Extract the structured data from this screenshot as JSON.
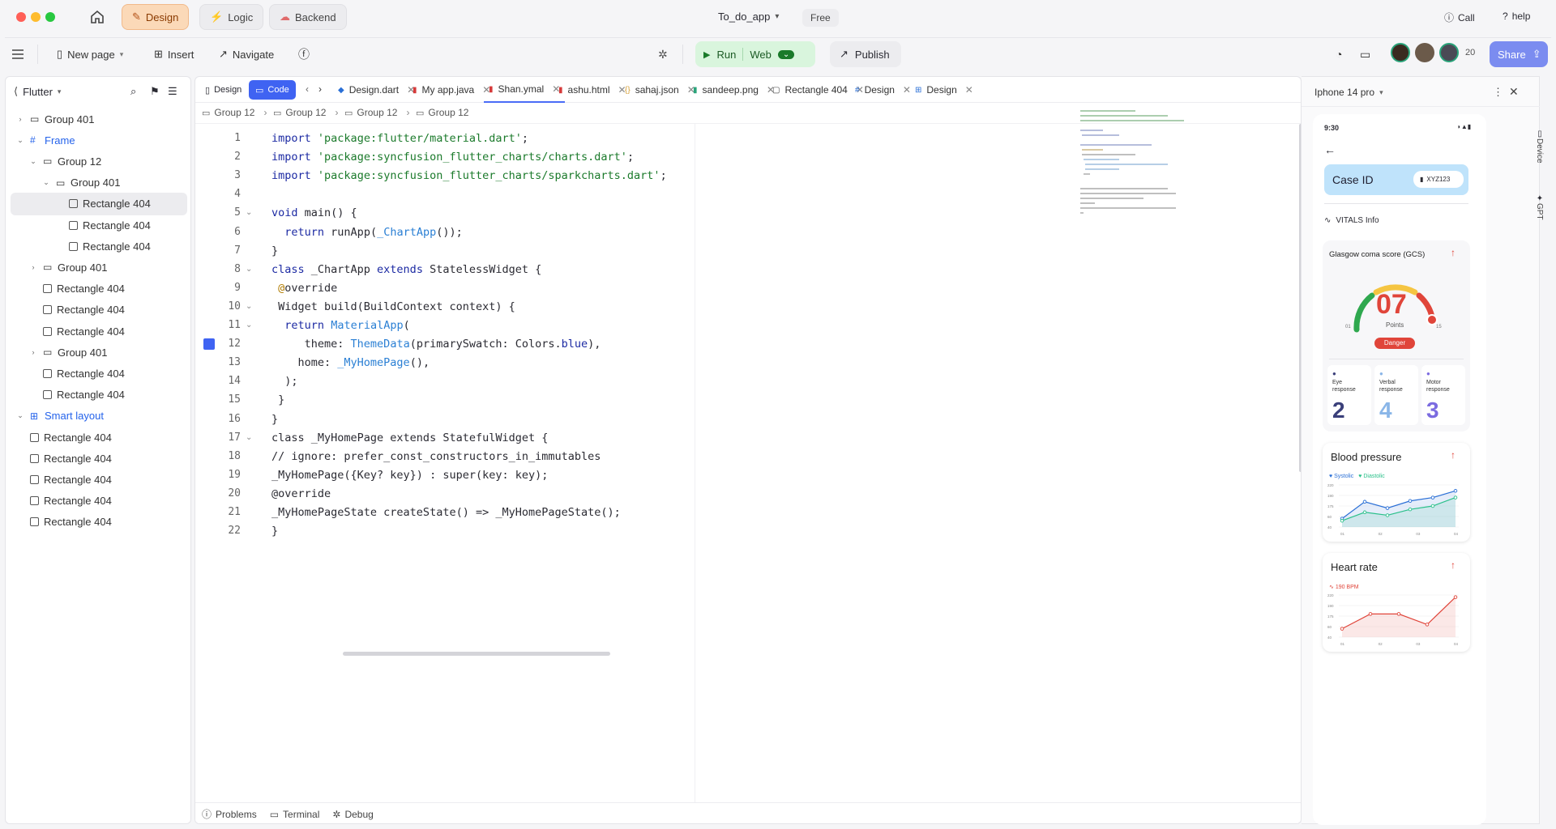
{
  "titlebar": {
    "modes": [
      {
        "label": "Design",
        "icon": "design-tools-icon",
        "active": true
      },
      {
        "label": "Logic",
        "icon": "lightning-icon",
        "active": false
      },
      {
        "label": "Backend",
        "icon": "cloud-icon",
        "active": false
      }
    ],
    "project_name": "To_do_app",
    "plan_badge": "Free",
    "call_label": "Call",
    "help_label": "help"
  },
  "toolbar": {
    "new_page": "New page",
    "insert": "Insert",
    "navigate": "Navigate",
    "run": "Run",
    "web": "Web",
    "publish": "Publish",
    "collaborator_count": "20",
    "share": "Share"
  },
  "sidebar": {
    "framework": "Flutter",
    "tree": [
      {
        "label": "Group 401",
        "type": "folder",
        "indent": 0,
        "chev": "right"
      },
      {
        "label": "Frame",
        "type": "frame",
        "indent": 0,
        "chev": "down",
        "blue": true
      },
      {
        "label": "Group 12",
        "type": "folder",
        "indent": 1,
        "chev": "down"
      },
      {
        "label": "Group 401",
        "type": "folder",
        "indent": 2,
        "chev": "down"
      },
      {
        "label": "Rectangle 404",
        "type": "rect",
        "indent": 3,
        "selected": true
      },
      {
        "label": "Rectangle 404",
        "type": "rect",
        "indent": 3
      },
      {
        "label": "Rectangle 404",
        "type": "rect",
        "indent": 3
      },
      {
        "label": "Group 401",
        "type": "folder",
        "indent": 1,
        "chev": "right"
      },
      {
        "label": "Rectangle 404",
        "type": "rect",
        "indent": 1
      },
      {
        "label": "Rectangle 404",
        "type": "rect",
        "indent": 1
      },
      {
        "label": "Rectangle 404",
        "type": "rect",
        "indent": 1
      },
      {
        "label": "Group 401",
        "type": "folder",
        "indent": 1,
        "chev": "right"
      },
      {
        "label": "Rectangle 404",
        "type": "rect",
        "indent": 1
      },
      {
        "label": "Rectangle 404",
        "type": "rect",
        "indent": 1
      },
      {
        "label": "Smart layout",
        "type": "layout",
        "indent": 0,
        "chev": "down",
        "blue": true
      },
      {
        "label": "Rectangle 404",
        "type": "rect",
        "indent": 0
      },
      {
        "label": "Rectangle 404",
        "type": "rect",
        "indent": 0
      },
      {
        "label": "Rectangle 404",
        "type": "rect",
        "indent": 0
      },
      {
        "label": "Rectangle 404",
        "type": "rect",
        "indent": 0
      },
      {
        "label": "Rectangle 404",
        "type": "rect",
        "indent": 0
      }
    ]
  },
  "editor": {
    "view_toggle": {
      "design": "Design",
      "code": "Code"
    },
    "tabs": [
      {
        "label": "Design.dart",
        "icon": "dart-icon",
        "color": "#2a6fd6"
      },
      {
        "label": "My app.java",
        "icon": "java-icon",
        "color": "#d63a3a"
      },
      {
        "label": "Shan.ymal",
        "icon": "yaml-icon",
        "color": "#d63a3a",
        "active": true
      },
      {
        "label": "ashu.html",
        "icon": "html-icon",
        "color": "#d63a3a"
      },
      {
        "label": "sahaj.json",
        "icon": "json-icon",
        "color": "#d6a13a"
      },
      {
        "label": "sandeep.png",
        "icon": "image-icon",
        "color": "#2aa37a"
      },
      {
        "label": "Rectangle 404",
        "icon": "rectangle-icon",
        "color": "#444"
      },
      {
        "label": "Design",
        "icon": "frame-icon",
        "color": "#2a6fd6"
      },
      {
        "label": "Design",
        "icon": "layout-icon",
        "color": "#2a6fd6"
      }
    ],
    "breadcrumbs": [
      "Group 12",
      "Group 12",
      "Group 12",
      "Group 12"
    ],
    "lines": [
      {
        "n": "1",
        "html": "<span class='kw'>import</span> <span class='str'>'package:flutter/material.dart'</span>;"
      },
      {
        "n": "2",
        "html": "<span class='kw'>import</span> <span class='str'>'package:syncfusion_flutter_charts/charts.dart'</span>;"
      },
      {
        "n": "3",
        "html": "<span class='kw'>import</span> <span class='str'>'package:syncfusion_flutter_charts/sparkcharts.dart'</span>;"
      },
      {
        "n": "4",
        "html": ""
      },
      {
        "n": "5",
        "html": "<span class='kw'>void</span> main() {",
        "fold": true
      },
      {
        "n": "6",
        "html": "  <span class='kw'>return</span> runApp(<span class='cls'>_ChartApp</span>());"
      },
      {
        "n": "7",
        "html": "}"
      },
      {
        "n": "8",
        "html": "<span class='kw'>class</span> _ChartApp <span class='kw'>extends</span> StatelessWidget {",
        "fold": true
      },
      {
        "n": "9",
        "html": " <span class='ann'>@</span>override"
      },
      {
        "n": "10",
        "html": " Widget build(BuildContext context) {",
        "fold": true
      },
      {
        "n": "11",
        "html": "  <span class='kw'>return</span> <span class='cls'>MaterialApp</span>(",
        "fold": true
      },
      {
        "n": "12",
        "html": "     theme: <span class='cls'>ThemeData</span>(primarySwatch: Colors.<span class='kw'>blue</span>),",
        "marker": true
      },
      {
        "n": "13",
        "html": "    home: <span class='cls'>_MyHomePage</span>(),"
      },
      {
        "n": "14",
        "html": "  );"
      },
      {
        "n": "15",
        "html": " }"
      },
      {
        "n": "16",
        "html": "}"
      },
      {
        "n": "17",
        "html": "class _MyHomePage extends StatefulWidget {",
        "fold": true
      },
      {
        "n": "18",
        "html": "// ignore: prefer_const_constructors_in_immutables"
      },
      {
        "n": "19",
        "html": "_MyHomePage({Key? key}) : super(key: key);"
      },
      {
        "n": "20",
        "html": "@override"
      },
      {
        "n": "21",
        "html": "_MyHomePageState createState() => _MyHomePageState();"
      },
      {
        "n": "22",
        "html": "}"
      }
    ],
    "status": {
      "problems": "Problems",
      "terminal": "Terminal",
      "debug": "Debug"
    }
  },
  "device": {
    "name": "Iphone 14 pro",
    "time": "9:30",
    "case_label": "Case ID",
    "case_id": "XYZ123",
    "vitals_label": "VITALS Info",
    "gcs": {
      "title": "Glasgow coma score (GCS)",
      "value": "07",
      "unit": "Points",
      "min": "01",
      "max": "15",
      "status": "Danger",
      "level": 0.43
    },
    "responses": [
      {
        "label_1": "Eye",
        "label_2": "response",
        "value": "2",
        "color": "#3a3f7a",
        "icon_color": "#3a3f7a"
      },
      {
        "label_1": "Verbal",
        "label_2": "response",
        "value": "4",
        "color": "#8ab6e8",
        "icon_color": "#8ab6e8"
      },
      {
        "label_1": "Motor",
        "label_2": "response",
        "value": "3",
        "color": "#7b6be0",
        "icon_color": "#7b6be0"
      }
    ],
    "bp": {
      "title": "Blood pressure",
      "systolic": "Systolic",
      "diastolic": "Diastolic",
      "yticks": [
        "220",
        "190",
        "175",
        "60",
        "40"
      ],
      "xticks": [
        "01",
        "02",
        "03",
        "04"
      ]
    },
    "hr": {
      "title": "Heart rate",
      "legend": "190 BPM",
      "yticks": [
        "220",
        "190",
        "175",
        "60",
        "40"
      ],
      "xticks": [
        "01",
        "02",
        "03",
        "04"
      ]
    }
  },
  "rightrail": {
    "device": "Device",
    "gpt": "GPT"
  }
}
